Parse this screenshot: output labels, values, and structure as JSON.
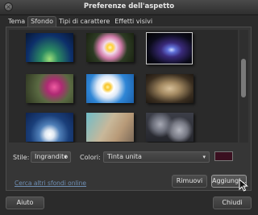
{
  "window": {
    "title": "Preferenze dell'aspetto"
  },
  "tabs": [
    {
      "label": "Tema"
    },
    {
      "label": "Sfondo"
    },
    {
      "label": "Tipi di carattere"
    },
    {
      "label": "Effetti visivi"
    }
  ],
  "options": {
    "style_label": "Stile:",
    "style_value": "Ingrandito",
    "colors_label": "Colori:",
    "colors_value": "Tinta unita",
    "swatch_color": "#3a1020"
  },
  "link": {
    "text": "Cerca altri sfondi online"
  },
  "buttons": {
    "remove": "Rimuovi",
    "add": "Aggiungi...",
    "help": "Aiuto",
    "close": "Chiudi"
  }
}
